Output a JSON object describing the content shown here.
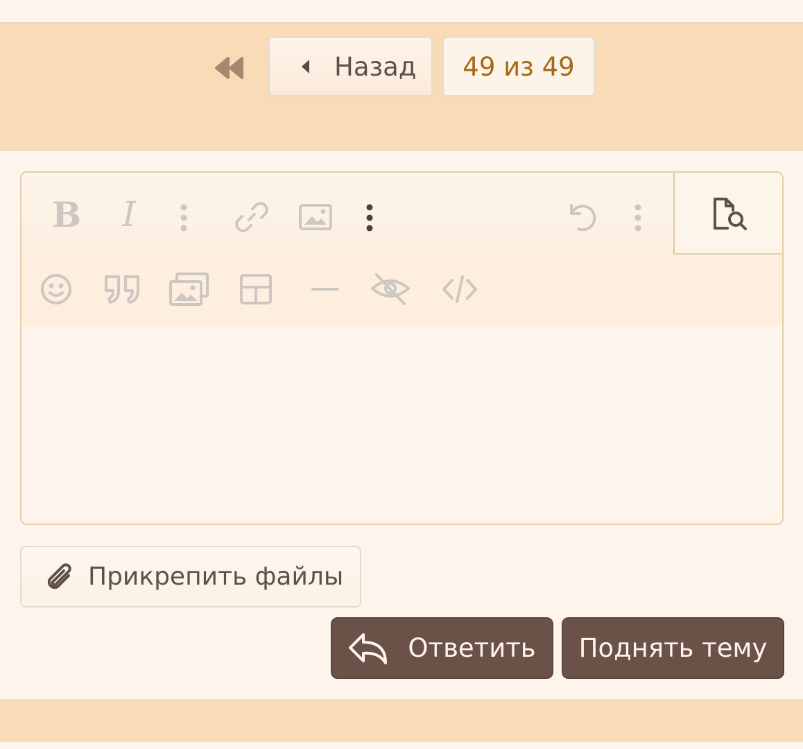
{
  "pagination": {
    "prev_label": "Назад",
    "page_indicator": "49 из 49"
  },
  "editor": {
    "toolbar_row1": [
      "bold-icon",
      "italic-icon",
      "more-vertical-icon",
      "link-icon",
      "image-icon",
      "more-vertical-icon",
      "undo-icon",
      "more-vertical-icon",
      "preview-icon"
    ],
    "toolbar_row2": [
      "smiley-icon",
      "quote-icon",
      "media-gallery-icon",
      "table-icon",
      "horizontal-line-icon",
      "hide-icon",
      "code-icon"
    ],
    "bold_glyph": "B",
    "italic_glyph": "I"
  },
  "actions": {
    "attach_label": "Прикрепить файлы",
    "reply_label": "Ответить",
    "bump_label": "Поднять тему"
  },
  "colors": {
    "bar": "#f9dbb8",
    "page": "#fdf5ec",
    "accent_text": "#a46817",
    "dark_button": "#6b5249"
  }
}
